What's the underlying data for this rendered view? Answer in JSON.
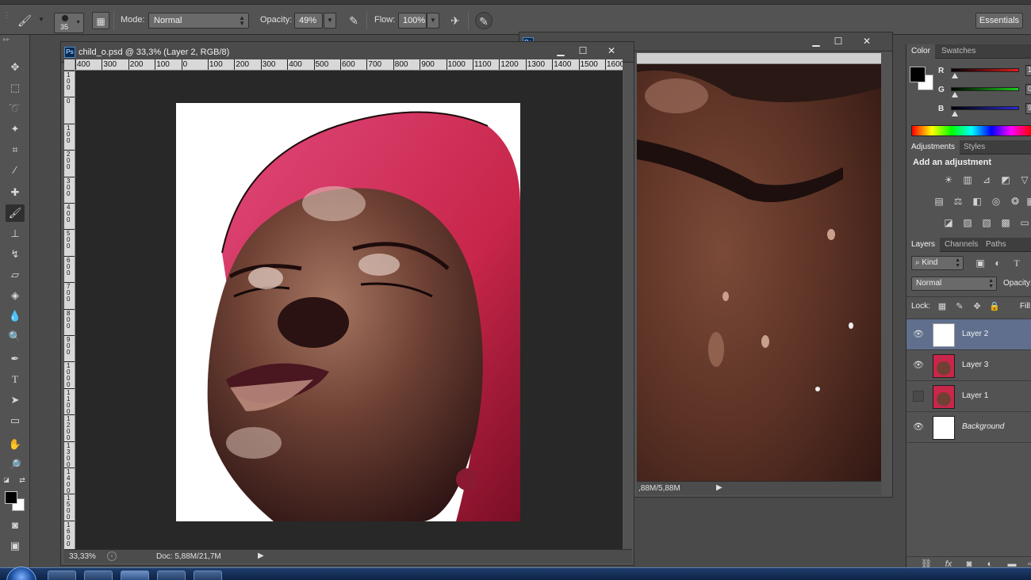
{
  "options_bar": {
    "brush_size": "35",
    "mode_label": "Mode:",
    "mode_value": "Normal",
    "opacity_label": "Opacity:",
    "opacity_value": "49%",
    "flow_label": "Flow:",
    "flow_value": "100%",
    "workspace": "Essentials"
  },
  "main_document": {
    "title": "child_o.psd @ 33,3% (Layer 2, RGB/8)",
    "zoom": "33,33%",
    "doc_info": "Doc: 5,88M/21,7M",
    "ruler_h": [
      "400",
      "300",
      "200",
      "100",
      "0",
      "100",
      "200",
      "300",
      "400",
      "500",
      "600",
      "700",
      "800",
      "900",
      "1000",
      "1100",
      "1200",
      "1300",
      "1400",
      "1500",
      "1600"
    ],
    "ruler_v": [
      "1\n0\n0",
      "0",
      "1\n0\n0",
      "2\n0\n0",
      "3\n0\n0",
      "4\n0\n0",
      "5\n0\n0",
      "6\n0\n0",
      "7\n0\n0",
      "8\n0\n0",
      "9\n0\n0",
      "1\n0\n0\n0",
      "1\n1\n0\n0",
      "1\n2\n0\n0",
      "1\n3\n0\n0",
      "1\n4\n0\n0",
      "1\n5\n0\n0",
      "1\n6\n0\n0"
    ]
  },
  "second_document": {
    "doc_info": ",88M/5,88M"
  },
  "color_panel": {
    "tabs": [
      "Color",
      "Swatches"
    ],
    "channels": [
      {
        "label": "R",
        "value": "1",
        "gradient": "#e31b1b"
      },
      {
        "label": "G",
        "value": "0",
        "gradient": "#1bd11b"
      },
      {
        "label": "B",
        "value": "9",
        "gradient": "#2b2bd6"
      }
    ]
  },
  "adjustments_panel": {
    "tabs": [
      "Adjustments",
      "Styles"
    ],
    "heading": "Add an adjustment"
  },
  "layers_panel": {
    "tabs": [
      "Layers",
      "Channels",
      "Paths"
    ],
    "filter_kind": "Kind",
    "blend_mode": "Normal",
    "opacity_label": "Opacity:",
    "lock_label": "Lock:",
    "fill_label": "Fill:",
    "layers": [
      {
        "name": "Layer 2",
        "visible": true,
        "selected": true
      },
      {
        "name": "Layer 3",
        "visible": true,
        "selected": false
      },
      {
        "name": "Layer 1",
        "visible": false,
        "selected": false
      },
      {
        "name": "Background",
        "visible": true,
        "selected": false
      }
    ],
    "footer_icons": [
      "link-icon",
      "fx-icon",
      "mask-icon",
      "adjustment-layer-icon",
      "folder-icon",
      "new-layer-icon"
    ]
  },
  "colors": {
    "ui_dark": "#535353",
    "canvas_bg": "#282828",
    "selection": "#5f6f8d",
    "hood_red": "#c8264a"
  }
}
